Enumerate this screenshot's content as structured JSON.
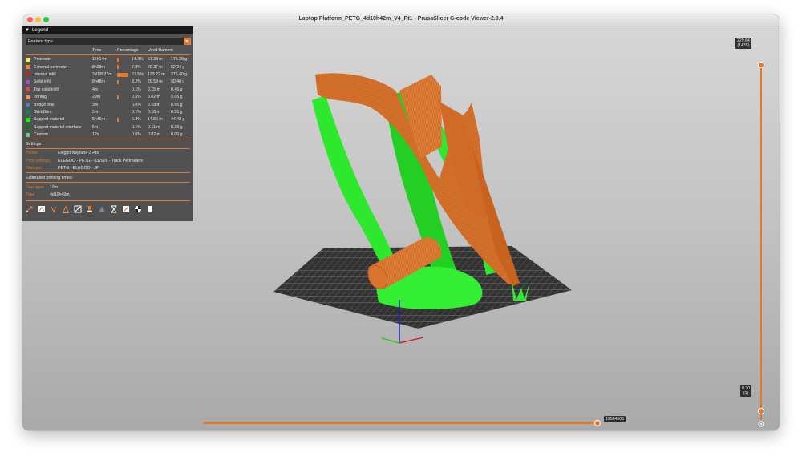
{
  "window": {
    "title": "Laptop Platform_PETG_4d10h42m_V4_Pt1 - PrusaSlicer G-code Viewer-2.9.4",
    "traffic_colors": [
      "#ff5f57",
      "#febc2e",
      "#28c840"
    ]
  },
  "legend": {
    "title": "Legend",
    "view_type": "Feature type",
    "columns": {
      "time": "Time",
      "percentage": "Percentage",
      "used_filament": "Used filament"
    },
    "rows": [
      {
        "name": "Perimeter",
        "color": "#ffe64d",
        "time": "15h14m",
        "percentage": "14.3%",
        "pct_value": 14.3,
        "length": "57.38 m",
        "weight": "175.29 g"
      },
      {
        "name": "External perimeter",
        "color": "#ff7d38",
        "time": "8h29m",
        "percentage": "7.8%",
        "pct_value": 7.8,
        "length": "20.37 m",
        "weight": "62.24 g"
      },
      {
        "name": "Internal infill",
        "color": "#b03029",
        "time": "2d13h27m",
        "percentage": "57.5%",
        "pct_value": 57.5,
        "length": "123.22 m",
        "weight": "376.40 g"
      },
      {
        "name": "Solid infill",
        "color": "#9654cc",
        "time": "8h48m",
        "percentage": "8.2%",
        "pct_value": 8.2,
        "length": "29.59 m",
        "weight": "90.40 g"
      },
      {
        "name": "Top solid infill",
        "color": "#f04040",
        "time": "4m",
        "percentage": "0.1%",
        "pct_value": 0.1,
        "length": "0.15 m",
        "weight": "0.46 g"
      },
      {
        "name": "Ironing",
        "color": "#ff8c69",
        "time": "29m",
        "percentage": "0.5%",
        "pct_value": 0.5,
        "length": "0.02 m",
        "weight": "0.06 g"
      },
      {
        "name": "Bridge infill",
        "color": "#4d80ba",
        "time": "3m",
        "percentage": "0.0%",
        "pct_value": 0.0,
        "length": "0.18 m",
        "weight": "0.56 g"
      },
      {
        "name": "Skirt/Brim",
        "color": "#00876e",
        "time": "5m",
        "percentage": "0.1%",
        "pct_value": 0.1,
        "length": "0.18 m",
        "weight": "0.56 g"
      },
      {
        "name": "Support material",
        "color": "#00ff00",
        "time": "5h46m",
        "percentage": "5.4%",
        "pct_value": 5.4,
        "length": "14.56 m",
        "weight": "44.48 g"
      },
      {
        "name": "Support material interface",
        "color": "#008000",
        "time": "6m",
        "percentage": "0.1%",
        "pct_value": 0.1,
        "length": "0.11 m",
        "weight": "0.33 g"
      },
      {
        "name": "Custom",
        "color": "#5ed194",
        "time": "12s",
        "percentage": "0.0%",
        "pct_value": 0.0,
        "length": "0.02 m",
        "weight": "0.06 g"
      }
    ],
    "settings": {
      "heading": "Settings",
      "printer_label": "Printer",
      "printer": "Elegoo Neptune-3 Pro",
      "print_label": "Print settings",
      "print": "ELEGOO - PETG - 032926 - Thick Perimeters",
      "filament_label": "Filament",
      "filament": "PETG - ELEGOO - JF"
    },
    "times": {
      "heading": "Estimated printing times:",
      "first_layer_label": "First layer",
      "first_layer": "19m",
      "total_label": "Total",
      "total": "4d10h49m"
    },
    "toolbar_icons": [
      "travel-icon",
      "wipe-icon",
      "retraction-icon",
      "deretraction-icon",
      "seam-icon",
      "tool-change-icon",
      "color-change-icon",
      "pause-icon",
      "custom-gcode-icon",
      "center-of-gravity-icon",
      "shells-icon",
      "tool-marker-icon"
    ]
  },
  "sliders": {
    "vertical_top": {
      "height": "229.64",
      "layer": "(1435)"
    },
    "vertical_bottom": {
      "height": "0.20",
      "layer": "(1)"
    },
    "horizontal": {
      "value": "12564505"
    }
  },
  "colors": {
    "accent": "#e07a30",
    "model": "#d9742e",
    "support": "#2ee82e"
  }
}
